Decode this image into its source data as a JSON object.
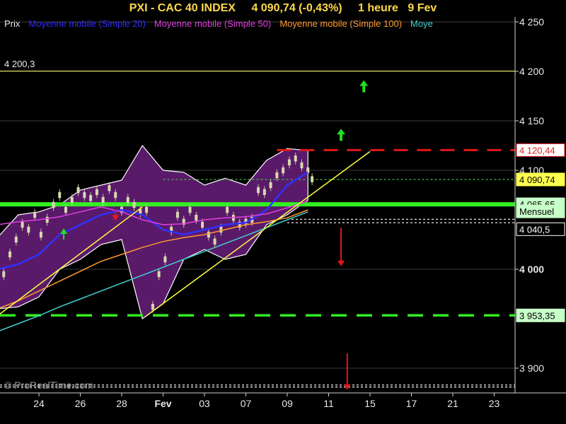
{
  "header": {
    "symbol": "PXI - CAC 40 INDEX",
    "last": "4 090,74 (-0,43%)",
    "interval": "1 heure",
    "date": "9 Fev"
  },
  "legend": [
    {
      "label": "Prix",
      "color": "#e8e8e8"
    },
    {
      "label": "Moyenne mobile (Simple 20)",
      "color": "#3030ff"
    },
    {
      "label": "Moyenne mobile (Simple 50)",
      "color": "#e040e0"
    },
    {
      "label": "Moyenne mobile (Simple 100)",
      "color": "#ff9a30"
    },
    {
      "label": "Moye",
      "color": "#40d0d0"
    }
  ],
  "watermark": "© ProRealTime.com",
  "level_label_left": "4 200,3",
  "price_tags": [
    {
      "text": "4 120,44",
      "value": 4120.44,
      "bg": "#ffffff",
      "fg": "#e02020",
      "border": "#e02020"
    },
    {
      "text": "4 090,74",
      "value": 4090.74,
      "bg": "#ffff50",
      "fg": "#000000",
      "border": "#ffff50"
    },
    {
      "text": "4 065,65",
      "value": 4065.65,
      "bg": "#c8ffc8",
      "fg": "#000000",
      "border": "#c8ffc8"
    },
    {
      "text": "Mensuel",
      "value": 4058.5,
      "bg": "#c8ffc8",
      "fg": "#000000",
      "border": "#c8ffc8"
    },
    {
      "text": "4 040,5",
      "value": 4040.5,
      "bg": "#000000",
      "fg": "#ffffff",
      "border": "#ffffff"
    },
    {
      "text": "3 953,35",
      "value": 3953.35,
      "bg": "#c8ffc8",
      "fg": "#000000",
      "border": "#c8ffc8"
    }
  ],
  "colors": {
    "background": "#000000",
    "header_text": "#ffd84a",
    "support_green": "#33ee22",
    "resistance_red": "#e01818",
    "trend_yellow": "#ffff40",
    "bollinger_fill": "#5a1a6a",
    "arrow_green": "#22dd22",
    "arrow_red": "#e01818"
  },
  "chart_data": {
    "type": "line",
    "title": "PXI - CAC 40 INDEX",
    "ylim": [
      3875,
      4255
    ],
    "y_ticks": [
      {
        "value": 4250,
        "label": "4 250"
      },
      {
        "value": 4200,
        "label": "4 200"
      },
      {
        "value": 4150,
        "label": "4 150"
      },
      {
        "value": 4100,
        "label": "4 100"
      },
      {
        "value": 4000,
        "label": "4 000"
      },
      {
        "value": 3900,
        "label": "3 900"
      }
    ],
    "x_ticks": [
      {
        "index": 0,
        "label": "24"
      },
      {
        "index": 1,
        "label": "26"
      },
      {
        "index": 2,
        "label": "28"
      },
      {
        "index": 3,
        "label": "Fev"
      },
      {
        "index": 4,
        "label": "03"
      },
      {
        "index": 5,
        "label": "07"
      },
      {
        "index": 6,
        "label": "09"
      },
      {
        "index": 7,
        "label": "11"
      },
      {
        "index": 8,
        "label": "15"
      },
      {
        "index": 9,
        "label": "17"
      },
      {
        "index": 10,
        "label": "21"
      },
      {
        "index": 11,
        "label": "23"
      }
    ],
    "price_points": [
      [
        -1.0,
        4010
      ],
      [
        -0.85,
        3995
      ],
      [
        -0.7,
        4015
      ],
      [
        -0.55,
        4030
      ],
      [
        -0.4,
        4045
      ],
      [
        -0.25,
        4040
      ],
      [
        -0.1,
        4055
      ],
      [
        0.05,
        4035
      ],
      [
        0.2,
        4050
      ],
      [
        0.35,
        4065
      ],
      [
        0.5,
        4075
      ],
      [
        0.65,
        4060
      ],
      [
        0.8,
        4070
      ],
      [
        0.95,
        4080
      ],
      [
        1.1,
        4075
      ],
      [
        1.25,
        4072
      ],
      [
        1.4,
        4078
      ],
      [
        1.55,
        4070
      ],
      [
        1.7,
        4082
      ],
      [
        1.85,
        4075
      ],
      [
        2.0,
        4060
      ],
      [
        2.15,
        4070
      ],
      [
        2.3,
        4065
      ],
      [
        2.45,
        4058
      ],
      [
        2.6,
        4060
      ],
      [
        2.75,
        3962
      ],
      [
        2.9,
        3995
      ],
      [
        3.05,
        4010
      ],
      [
        3.2,
        4040
      ],
      [
        3.35,
        4055
      ],
      [
        3.5,
        4048
      ],
      [
        3.65,
        4060
      ],
      [
        3.8,
        4052
      ],
      [
        3.95,
        4045
      ],
      [
        4.1,
        4035
      ],
      [
        4.25,
        4028
      ],
      [
        4.4,
        4040
      ],
      [
        4.55,
        4060
      ],
      [
        4.7,
        4052
      ],
      [
        4.85,
        4045
      ],
      [
        5.0,
        4048
      ],
      [
        5.15,
        4050
      ],
      [
        5.3,
        4080
      ],
      [
        5.45,
        4078
      ],
      [
        5.6,
        4085
      ],
      [
        5.75,
        4095
      ],
      [
        5.9,
        4100
      ],
      [
        6.05,
        4108
      ],
      [
        6.2,
        4112
      ],
      [
        6.35,
        4105
      ],
      [
        6.5,
        4100
      ],
      [
        6.6,
        4091
      ]
    ],
    "series": [
      {
        "name": "Moyenne mobile (Simple 20)",
        "color": "#3030ff",
        "x": [
          -1.0,
          -0.5,
          0.0,
          0.5,
          1.0,
          1.5,
          2.0,
          2.5,
          3.0,
          3.5,
          4.0,
          4.5,
          5.0,
          5.5,
          6.0,
          6.5
        ],
        "y": [
          4000,
          4005,
          4015,
          4035,
          4045,
          4055,
          4060,
          4055,
          4040,
          4035,
          4040,
          4045,
          4047,
          4060,
          4085,
          4098
        ]
      },
      {
        "name": "Moyenne mobile (Simple 50)",
        "color": "#e040e0",
        "x": [
          -1.0,
          -0.5,
          0.0,
          0.5,
          1.0,
          1.5,
          2.0,
          2.5,
          3.0,
          3.5,
          4.0,
          4.5,
          5.0,
          5.5,
          6.0,
          6.5
        ],
        "y": [
          4045,
          4048,
          4050,
          4053,
          4058,
          4063,
          4058,
          4050,
          4045,
          4046,
          4050,
          4052,
          4053,
          4056,
          4062,
          4069
        ]
      },
      {
        "name": "Moyenne mobile (Simple 100)",
        "color": "#ff9a30",
        "x": [
          -1.0,
          -0.5,
          0.0,
          0.5,
          1.0,
          1.5,
          2.0,
          2.5,
          3.0,
          3.5,
          4.0,
          4.5,
          5.0,
          5.5,
          6.0,
          6.5
        ],
        "y": [
          3960,
          3968,
          3978,
          3988,
          3998,
          4008,
          4015,
          4022,
          4028,
          4032,
          4035,
          4040,
          4045,
          4048,
          4052,
          4060
        ]
      },
      {
        "name": "Moye",
        "color": "#40d0d0",
        "x": [
          -1.0,
          -0.5,
          0.0,
          0.5,
          1.0,
          1.5,
          2.0,
          2.5,
          3.0,
          3.5,
          4.0,
          4.5,
          5.0,
          5.5,
          6.0,
          6.5
        ],
        "y": [
          3937,
          3945,
          3953,
          3962,
          3970,
          3978,
          3986,
          3994,
          4002,
          4010,
          4018,
          4026,
          4034,
          4042,
          4050,
          4058
        ]
      }
    ],
    "bollinger": {
      "x": [
        -1.0,
        -0.5,
        0.0,
        0.5,
        1.0,
        1.5,
        2.0,
        2.5,
        3.0,
        3.5,
        4.0,
        4.5,
        5.0,
        5.5,
        6.0,
        6.5
      ],
      "upper": [
        4032,
        4055,
        4058,
        4065,
        4080,
        4085,
        4090,
        4125,
        4100,
        4098,
        4085,
        4092,
        4085,
        4110,
        4122,
        4120
      ],
      "lower": [
        3960,
        3962,
        3972,
        4000,
        4010,
        4025,
        4030,
        3950,
        3965,
        4010,
        4020,
        4010,
        4015,
        4045,
        4055,
        4070
      ]
    },
    "horizontal_lines": [
      {
        "value": 4200.3,
        "style": "solid",
        "color": "#e8e860"
      },
      {
        "value": 4120.44,
        "style": "dashed",
        "color": "#e01818",
        "x_from": 5.75
      },
      {
        "value": 4090.74,
        "style": "dotted",
        "color": "#40c040",
        "x_from": 3.0
      },
      {
        "value": 4065.65,
        "style": "solid-thick",
        "color": "#33ee22"
      },
      {
        "value": 4050.5,
        "style": "dotted",
        "color": "#ffffff",
        "x_from": 6.0
      },
      {
        "value": 4047.0,
        "style": "dotted",
        "color": "#ffffff",
        "x_from": 6.0
      },
      {
        "value": 3953.35,
        "style": "dashed-thick",
        "color": "#33ee22"
      },
      {
        "value": 3883.0,
        "style": "dotted",
        "color": "#ffffff"
      },
      {
        "value": 3881.0,
        "style": "dotted",
        "color": "#ffffff"
      }
    ],
    "trend_lines": [
      {
        "from": [
          -1.0,
          3953
        ],
        "to": [
          2.5,
          4063
        ],
        "color": "#ffff40"
      },
      {
        "from": [
          2.6,
          3953
        ],
        "to": [
          8.0,
          4119
        ],
        "color": "#ffff40"
      }
    ],
    "arrows": [
      {
        "x": 7.85,
        "y": 4186,
        "dir": "up",
        "color": "#22dd22"
      },
      {
        "x": 7.3,
        "y": 4137,
        "dir": "up",
        "color": "#22dd22"
      },
      {
        "x": 7.3,
        "y": 4042,
        "dir": "down",
        "color": "#e01818",
        "y_end": 4003
      },
      {
        "x": 7.45,
        "y": 3915,
        "dir": "down",
        "color": "#e01818",
        "y_end": 3878
      },
      {
        "x": 1.85,
        "y": 4060,
        "dir": "down",
        "color": "#e01818",
        "y_end": 4049
      },
      {
        "x": 0.6,
        "y": 4030,
        "dir": "up",
        "color": "#22dd22",
        "y_end": 4040
      }
    ]
  }
}
